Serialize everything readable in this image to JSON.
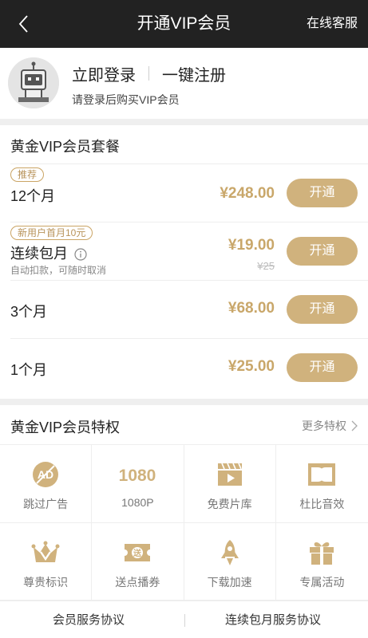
{
  "header": {
    "title": "开通VIP会员",
    "service": "在线客服"
  },
  "login": {
    "login_label": "立即登录",
    "register_label": "一键注册",
    "hint": "请登录后购买VIP会员"
  },
  "packages": {
    "title": "黄金VIP会员套餐",
    "items": [
      {
        "tag": "推荐",
        "name": "12个月",
        "price": "¥248.00",
        "button": "开通"
      },
      {
        "tag": "新用户首月10元",
        "name": "连续包月",
        "sub": "自动扣款，可随时取消",
        "price": "¥19.00",
        "old_price": "¥25",
        "button": "开通"
      },
      {
        "name": "3个月",
        "price": "¥68.00",
        "button": "开通"
      },
      {
        "name": "1个月",
        "price": "¥25.00",
        "button": "开通"
      }
    ]
  },
  "privileges": {
    "title": "黄金VIP会员特权",
    "more": "更多特权",
    "items": [
      {
        "label": "跳过广告",
        "icon": "ad-skip-icon"
      },
      {
        "label": "1080P",
        "icon": "1080p-icon"
      },
      {
        "label": "免费片库",
        "icon": "film-library-icon"
      },
      {
        "label": "杜比音效",
        "icon": "dolby-icon"
      },
      {
        "label": "尊贵标识",
        "icon": "crown-icon"
      },
      {
        "label": "送点播券",
        "icon": "ticket-icon"
      },
      {
        "label": "下载加速",
        "icon": "rocket-icon"
      },
      {
        "label": "专属活动",
        "icon": "gift-icon"
      }
    ]
  },
  "footer": {
    "service_agreement": "会员服务协议",
    "auto_renew_agreement": "连续包月服务协议"
  },
  "colors": {
    "gold": "#d0b27d",
    "price_gold": "#c9a76a",
    "header_bg": "#222222"
  }
}
